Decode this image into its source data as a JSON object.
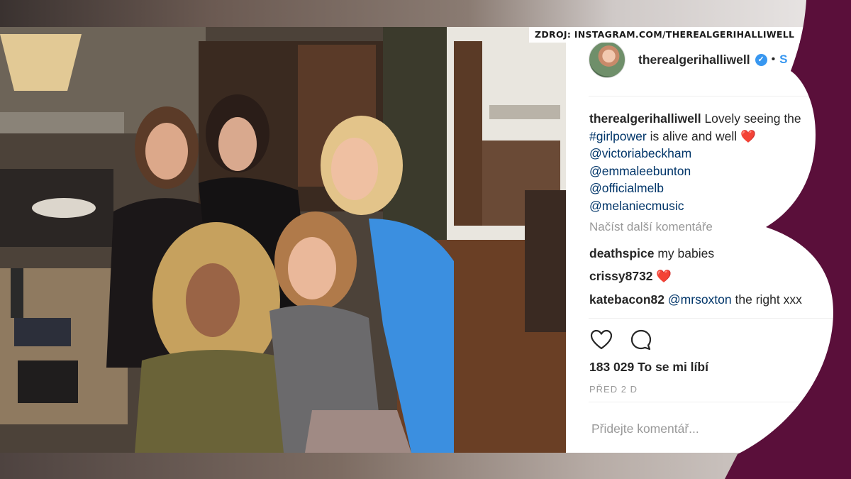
{
  "source": {
    "label": "ZDROJ: INSTAGRAM.COM/THEREALGERIHALLIWELL"
  },
  "post": {
    "username": "therealgerihalliwell",
    "verified_icon": "verified-badge-icon",
    "follow_label": "S",
    "caption": {
      "username": "therealgerihalliwell",
      "text": "Lovely seeing the",
      "line2_hashtag": "#girlpower",
      "line2_text": "is alive and well",
      "emoji": "❤️",
      "mentions": [
        "@victoriabeckham",
        "@emmaleebunton",
        "@officialmelb",
        "@melaniecmusic"
      ]
    },
    "load_more_label": "Načíst další komentáře",
    "comments": [
      {
        "username": "deathspice",
        "text": "my babies",
        "emoji": ""
      },
      {
        "username": "crissy8732",
        "text": "",
        "emoji": "❤️"
      },
      {
        "username": "katebacon82",
        "mention": "@mrsoxton",
        "text": "the right xxx",
        "emoji": ""
      }
    ],
    "actions": [
      "heart-icon",
      "comment-icon"
    ],
    "likes_label": "183 029 To se mi líbí",
    "time_label": "PŘED 2 D",
    "comment_placeholder": "Přidejte komentář..."
  },
  "photo": {
    "description_icon": "group-photo-image"
  },
  "logo": {
    "icon": "channel-logo-icon",
    "color": "#5a0f3a"
  }
}
